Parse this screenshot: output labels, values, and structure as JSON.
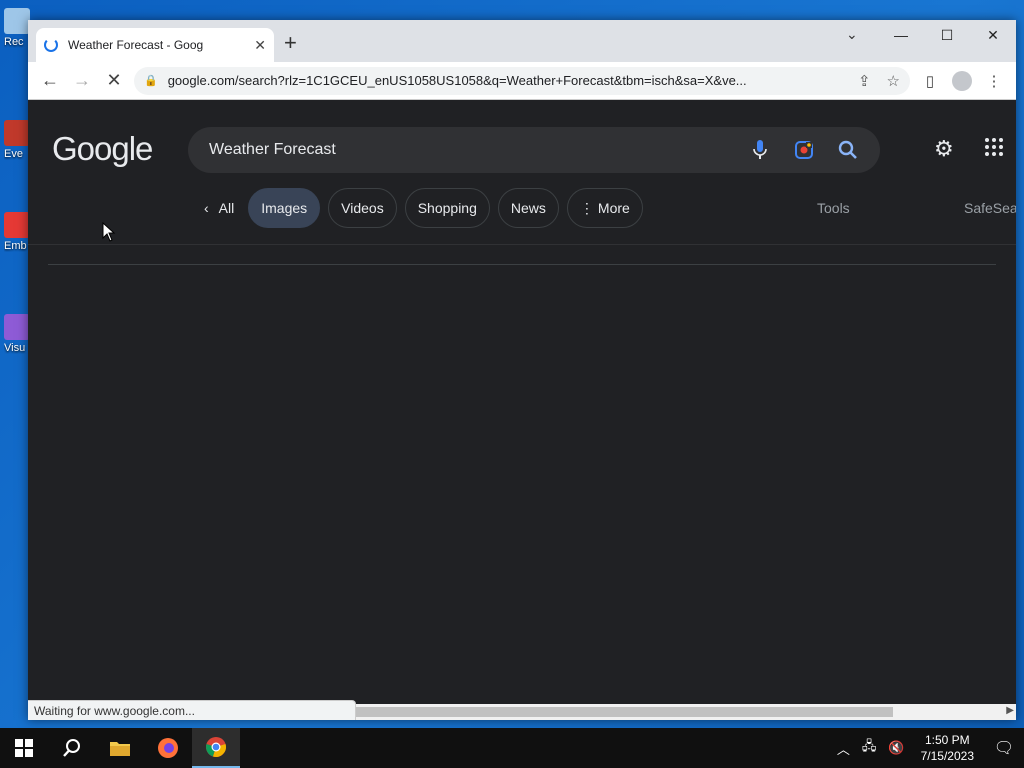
{
  "desktop": {
    "icons": [
      {
        "label": "Rec",
        "color": "#9ec6e8"
      },
      {
        "label": "Eve",
        "color": "#c0392b"
      },
      {
        "label": "Emb De",
        "color": "#e53935"
      },
      {
        "label": "Visu",
        "color": "#8e5bd6"
      }
    ]
  },
  "browser": {
    "tab_title": "Weather Forecast - Goog",
    "url": "google.com/search?rlz=1C1GCEU_enUS1058US1058&q=Weather+Forecast&tbm=isch&sa=X&ve...",
    "new_tab_symbol": "+"
  },
  "google": {
    "logo": "Google",
    "query": "Weather Forecast",
    "filters": {
      "all": "All",
      "images": "Images",
      "videos": "Videos",
      "shopping": "Shopping",
      "news": "News",
      "more": "More"
    },
    "tools": "Tools",
    "safesearch": "SafeSea"
  },
  "status": "Waiting for www.google.com...",
  "taskbar": {
    "time": "1:50 PM",
    "date": "7/15/2023"
  },
  "colors": {
    "accent": "#1a73e8",
    "page_bg": "#202124",
    "active_chip": "#394457"
  }
}
